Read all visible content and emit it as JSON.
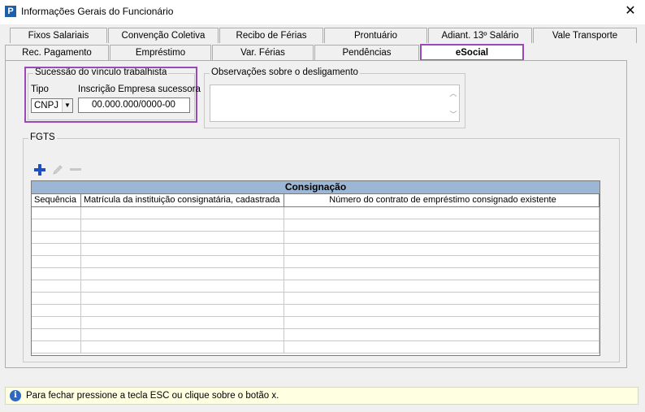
{
  "window": {
    "title": "Informações Gerais do Funcionário",
    "close_glyph": "✕",
    "app_icon": "P"
  },
  "tabs_row1": [
    "Fixos Salariais",
    "Convenção Coletiva",
    "Recibo de Férias",
    "Prontuário",
    "Adiant. 13º Salário",
    "Vale Transporte"
  ],
  "tabs_row2": [
    "Rec. Pagamento",
    "Empréstimo",
    "Var. Férias",
    "Pendências",
    "eSocial"
  ],
  "active_tab": "eSocial",
  "sucessao": {
    "legend": "Sucessão do vínculo trabalhista",
    "tipo_label": "Tipo",
    "tipo_value": "CNPJ",
    "inscricao_label": "Inscrição Empresa sucessora",
    "inscricao_value": "00.000.000/0000-00"
  },
  "observacoes": {
    "legend": "Observações sobre o desligamento",
    "value": ""
  },
  "fgts": {
    "legend": "FGTS",
    "toolbar": {
      "add_icon": "plus-icon",
      "edit_icon": "pencil-icon",
      "remove_icon": "minus-icon"
    },
    "grid": {
      "title": "Consignação",
      "columns": [
        "Sequência",
        "Matrícula da instituição consignatária, cadastrada",
        "Número do contrato de empréstimo consignado existente"
      ]
    }
  },
  "status": {
    "text": "Para fechar pressione a tecla ESC ou clique sobre o botão x."
  },
  "colors": {
    "highlight": "#9b49b8",
    "grid_title": "#9cb7d6",
    "status_bg": "#ffffe1",
    "accent": "#1f5fa8"
  }
}
